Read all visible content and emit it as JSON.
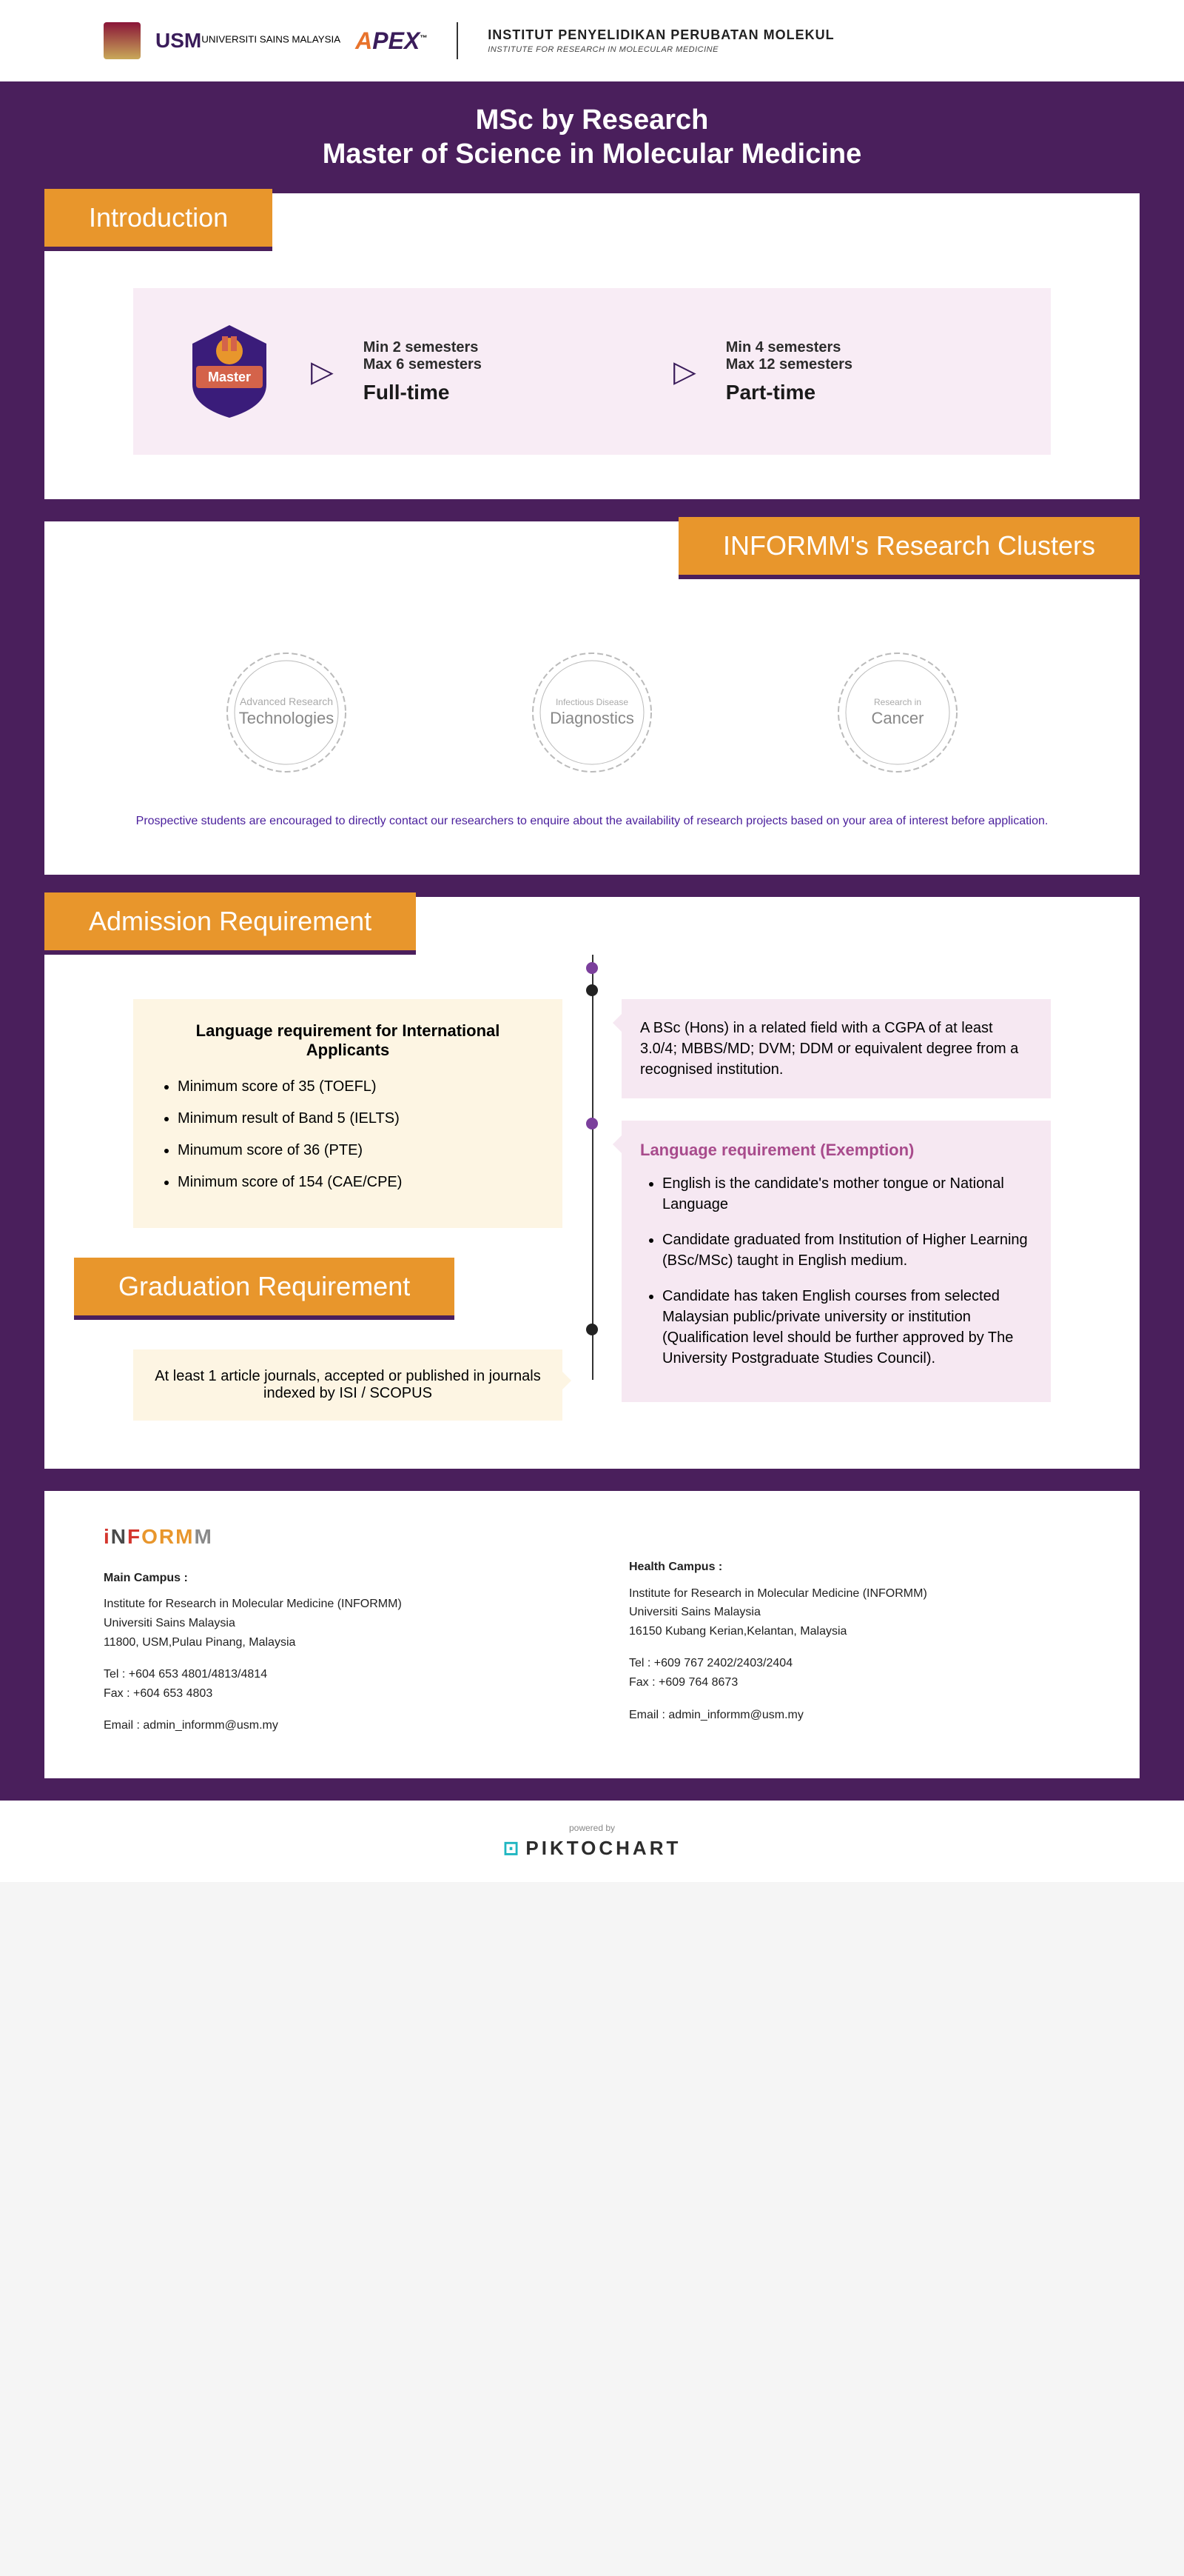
{
  "header": {
    "usm": "USM",
    "usm_sub": "UNIVERSITI SAINS MALAYSIA",
    "apex": "APEX",
    "inst_l1": "INSTITUT PENYELIDIKAN PERUBATAN MOLEKUL",
    "inst_l2": "INSTITUTE FOR RESEARCH IN MOLECULAR MEDICINE"
  },
  "title": {
    "l1": "MSc by Research",
    "l2": "Master of Science in Molecular Medicine"
  },
  "intro": {
    "tab": "Introduction",
    "badge": "Master",
    "full": {
      "min": "Min 2 semesters",
      "max": "Max 6 semesters",
      "type": "Full-time"
    },
    "part": {
      "min": "Min 4 semesters",
      "max": "Max 12 semesters",
      "type": "Part-time"
    }
  },
  "clusters": {
    "tab": "INFORMM's Research Clusters",
    "items": [
      {
        "sm": "Advanced Research",
        "lg": "Technologies"
      },
      {
        "sm": "Infectious Disease",
        "lg": "Diagnostics"
      },
      {
        "sm": "Research in",
        "lg": "Cancer"
      }
    ],
    "note": "Prospective students are encouraged to directly contact our researchers to enquire about the availability of research projects based on your area of interest before application."
  },
  "adm": {
    "tab": "Admission Requirement",
    "lang_title": "Language requirement for International Applicants",
    "lang_items": [
      "Minimum score of 35 (TOEFL)",
      "Minimum result of Band 5 (IELTS)",
      "Minumum score of 36 (PTE)",
      "Minimum score of 154 (CAE/CPE)"
    ],
    "bsc": "A BSc (Hons) in a related field with a CGPA of at least 3.0/4; MBBS/MD; DVM; DDM or equivalent degree from a recognised institution.",
    "exempt_title": "Language requirement (Exemption)",
    "exempt_items": [
      "English is the candidate's mother tongue or National Language",
      "Candidate graduated from Institution of Higher Learning (BSc/MSc) taught in English medium.",
      "Candidate has taken English courses from selected Malaysian public/private university or institution (Qualification level should be further approved by The University Postgraduate Studies Council)."
    ]
  },
  "grad": {
    "tab": "Graduation Requirement",
    "text": "At least 1 article journals, accepted or published in journals indexed by ISI / SCOPUS"
  },
  "footer": {
    "main": {
      "label": "Main Campus :",
      "addr": "Institute for Research in Molecular Medicine (INFORMM)\nUniversiti Sains Malaysia\n11800, USM,Pulau Pinang, Malaysia",
      "tel": "Tel : +604 653 4801/4813/4814",
      "fax": "Fax : +604 653 4803",
      "email": "Email : admin_informm@usm.my"
    },
    "health": {
      "label": "Health Campus :",
      "addr": "Institute for Research in Molecular Medicine (INFORMM)\nUniversiti Sains Malaysia\n16150 Kubang Kerian,Kelantan, Malaysia",
      "tel": "Tel : +609 767 2402/2403/2404",
      "fax": "Fax : +609 764 8673",
      "email": "Email : admin_informm@usm.my"
    }
  },
  "powered": {
    "by": "powered by",
    "name": "PIKTOCHART"
  }
}
